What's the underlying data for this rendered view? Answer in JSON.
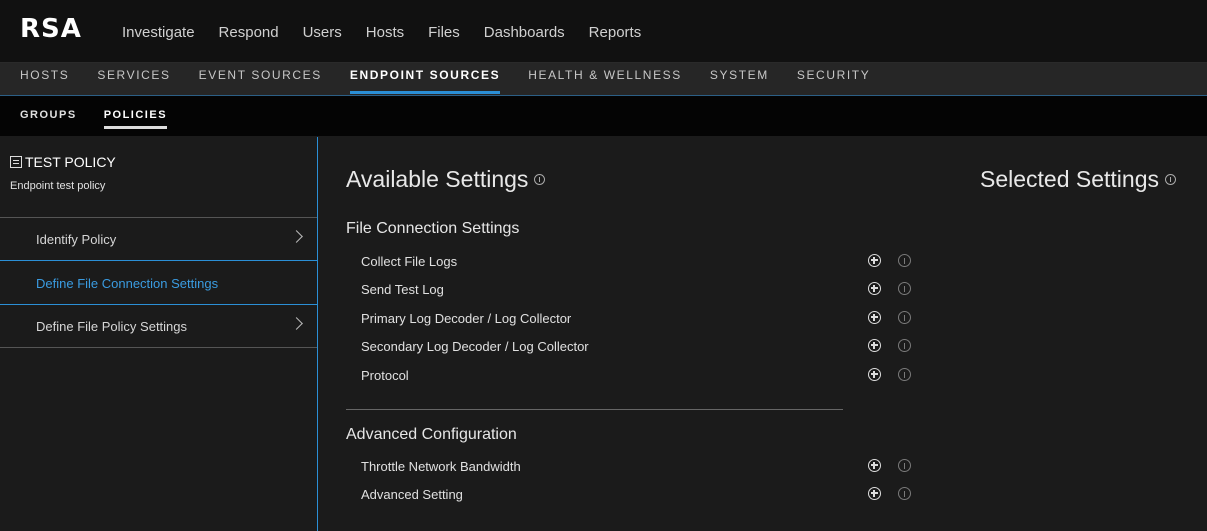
{
  "app": {
    "logo": "RSA"
  },
  "main_nav": [
    "Investigate",
    "Respond",
    "Users",
    "Hosts",
    "Files",
    "Dashboards",
    "Reports"
  ],
  "sub_nav": {
    "items": [
      "HOSTS",
      "SERVICES",
      "EVENT SOURCES",
      "ENDPOINT SOURCES",
      "HEALTH & WELLNESS",
      "SYSTEM",
      "SECURITY"
    ],
    "active": "ENDPOINT SOURCES"
  },
  "tabs": {
    "items": [
      "GROUPS",
      "POLICIES"
    ],
    "active": "POLICIES"
  },
  "policy": {
    "name": "TEST POLICY",
    "description": "Endpoint test policy"
  },
  "steps": [
    {
      "label": "Identify Policy"
    },
    {
      "label": "Define File Connection Settings",
      "active": true
    },
    {
      "label": "Define File Policy Settings"
    }
  ],
  "available": {
    "title": "Available Settings",
    "sections": [
      {
        "title": "File Connection Settings",
        "items": [
          "Collect File Logs",
          "Send Test Log",
          "Primary Log Decoder / Log Collector",
          "Secondary Log Decoder / Log Collector",
          "Protocol"
        ]
      },
      {
        "title": "Advanced Configuration",
        "items": [
          "Throttle Network Bandwidth",
          "Advanced Setting"
        ]
      }
    ]
  },
  "selected": {
    "title": "Selected Settings"
  },
  "colors": {
    "accent": "#2b8fd6",
    "active_link": "#3a9be0",
    "background": "#1b1b1b"
  },
  "icons": {
    "add": "plus-circle-icon",
    "info": "info-icon",
    "policy": "document-icon",
    "chevron": "chevron-right-icon"
  }
}
